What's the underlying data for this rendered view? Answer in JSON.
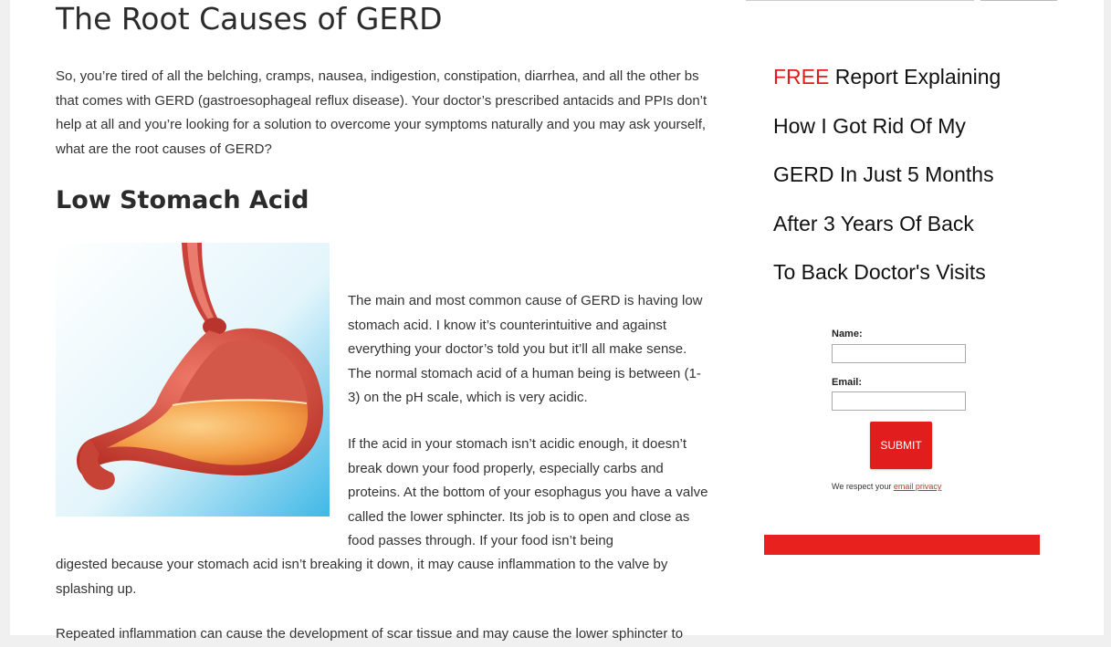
{
  "article": {
    "title": "The Root Causes of GERD",
    "intro": "So, you’re tired of all the belching, cramps, nausea, indigestion, constipation, diarrhea, and all the other bs that comes with GERD (gastroesophageal reflux disease). Your doctor’s prescribed antacids and PPIs don’t help at all and you’re looking for a solution to overcome your symptoms naturally and you may ask yourself,  what are the root causes of GERD?",
    "section_heading": "Low Stomach Acid",
    "image_icon": "stomach-illustration",
    "p2": "The main and most common cause of GERD is having low stomach acid. I know it’s counterintuitive and against everything your doctor’s told you but it’ll all make sense. The normal stomach acid of a human being is between (1-3) on the pH scale, which is very acidic.",
    "p3a": "If the acid in your stomach isn’t acidic enough, it doesn’t break down your food properly, especially carbs and proteins. At the bottom of your esophagus you have a valve called the lower sphincter.  Its job is to  open and close as food passes through. If your food isn’t being",
    "p3b": "digested because your stomach acid isn’t breaking it down, it may cause inflammation to the valve by splashing up.",
    "p4": "Repeated inflammation can cause the development of scar tissue and may cause the lower sphincter to"
  },
  "sidebar": {
    "promo_free": "FREE",
    "promo_line1_rest": " Report Explaining",
    "promo_line2": "How I Got Rid Of My",
    "promo_line3": "GERD In Just 5 Months",
    "promo_line4": "After 3 Years Of Back",
    "promo_line5": "To Back Doctor's Visits",
    "form": {
      "name_label": "Name:",
      "name_value": "",
      "email_label": "Email:",
      "email_value": "",
      "submit_label": "SUBMIT",
      "privacy_text": "We respect your ",
      "privacy_link": "email privacy"
    }
  },
  "colors": {
    "accent_red": "#e01d1d",
    "button_red": "#e21d1d",
    "bar_red": "#e8201e"
  }
}
